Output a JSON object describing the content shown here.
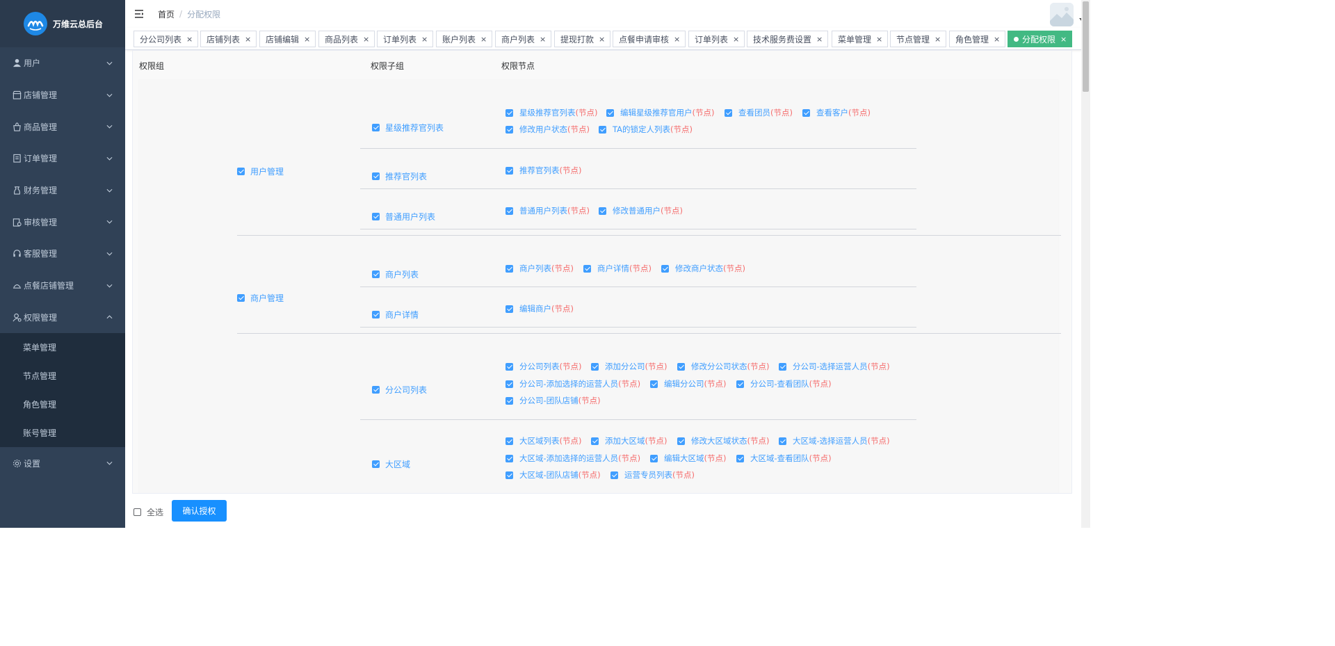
{
  "app": {
    "title": "万维云总后台"
  },
  "sidebar": {
    "items": [
      {
        "label": "用户",
        "icon": "user-icon"
      },
      {
        "label": "店铺管理",
        "icon": "store-icon"
      },
      {
        "label": "商品管理",
        "icon": "bag-icon"
      },
      {
        "label": "订单管理",
        "icon": "order-icon"
      },
      {
        "label": "财务管理",
        "icon": "finance-icon"
      },
      {
        "label": "审核管理",
        "icon": "audit-icon"
      },
      {
        "label": "客服管理",
        "icon": "headset-icon"
      },
      {
        "label": "点餐店铺管理",
        "icon": "dining-icon"
      },
      {
        "label": "权限管理",
        "icon": "permission-icon"
      }
    ],
    "submenu": [
      {
        "label": "菜单管理"
      },
      {
        "label": "节点管理"
      },
      {
        "label": "角色管理"
      },
      {
        "label": "账号管理"
      }
    ],
    "settings": {
      "label": "设置",
      "icon": "gear-icon"
    }
  },
  "header": {
    "breadcrumb": {
      "home": "首页",
      "separator": "/",
      "current": "分配权限"
    }
  },
  "tags": [
    {
      "label": "分公司列表"
    },
    {
      "label": "店铺列表"
    },
    {
      "label": "店铺编辑"
    },
    {
      "label": "商品列表"
    },
    {
      "label": "订单列表"
    },
    {
      "label": "账户列表"
    },
    {
      "label": "商户列表"
    },
    {
      "label": "提现打款"
    },
    {
      "label": "点餐申请审核"
    },
    {
      "label": "订单列表"
    },
    {
      "label": "技术服务费设置"
    },
    {
      "label": "菜单管理"
    },
    {
      "label": "节点管理"
    },
    {
      "label": "角色管理"
    },
    {
      "label": "分配权限",
      "active": true
    }
  ],
  "table": {
    "headers": {
      "group": "权限组",
      "subgroup": "权限子组",
      "node": "权限节点"
    },
    "node_suffix": "(节点)",
    "groups": [
      {
        "label": "用户管理",
        "subgroups": [
          {
            "label": "星级推荐官列表",
            "nodes": [
              "星级推荐官列表",
              "编辑星级推荐官用户",
              "查看团员",
              "查看客户",
              "修改用户状态",
              "TA的锁定人列表"
            ]
          },
          {
            "label": "推荐官列表",
            "nodes": [
              "推荐官列表"
            ]
          },
          {
            "label": "普通用户列表",
            "nodes": [
              "普通用户列表",
              "修改普通用户"
            ]
          }
        ]
      },
      {
        "label": "商户管理",
        "subgroups": [
          {
            "label": "商户列表",
            "nodes": [
              "商户列表",
              "商户详情",
              "修改商户状态"
            ]
          },
          {
            "label": "商户详情",
            "nodes": [
              "编辑商户"
            ]
          }
        ]
      },
      {
        "label": "",
        "subgroups": [
          {
            "label": "分公司列表",
            "nodes": [
              "分公司列表",
              "添加分公司",
              "修改分公司状态",
              "分公司-选择运营人员",
              "分公司-添加选择的运营人员",
              "编辑分公司",
              "分公司-查看团队",
              "分公司-团队店铺"
            ]
          },
          {
            "label": "大区域",
            "nodes": [
              "大区域列表",
              "添加大区域",
              "修改大区域状态",
              "大区域-选择运营人员",
              "大区域-添加选择的运营人员",
              "编辑大区域",
              "大区域-查看团队",
              "大区域-团队店铺",
              "运营专员列表"
            ]
          }
        ]
      }
    ]
  },
  "footer": {
    "select_all": "全选",
    "confirm": "确认授权"
  },
  "colors": {
    "sidebar": "#304156",
    "accent": "#409eff",
    "active_tag": "#42b983",
    "node_suffix": "#f56c6c",
    "button": "#1890ff"
  }
}
